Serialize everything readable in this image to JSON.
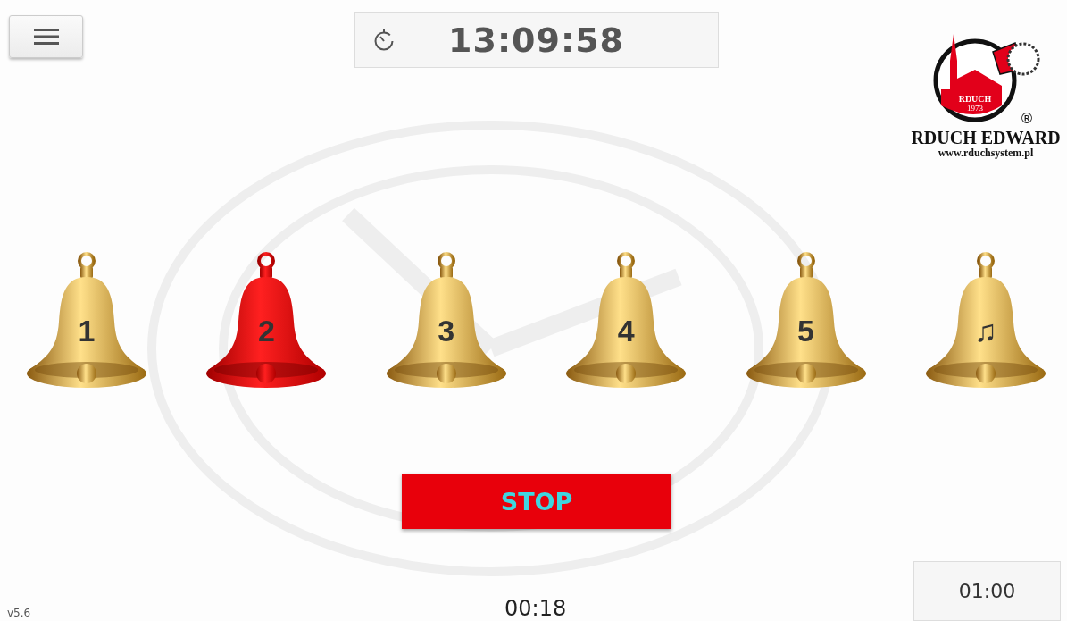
{
  "clock": {
    "time": "13:09:58"
  },
  "logo": {
    "badge_name": "RDUCH",
    "badge_year": "1973",
    "registered": "®",
    "company": "RDUCH EDWARD",
    "website": "www.rduchsystem.pl"
  },
  "bells": [
    {
      "label": "1",
      "selected": false
    },
    {
      "label": "2",
      "selected": true
    },
    {
      "label": "3",
      "selected": false
    },
    {
      "label": "4",
      "selected": false
    },
    {
      "label": "5",
      "selected": false
    },
    {
      "label": "♫",
      "selected": false
    }
  ],
  "stop_button": {
    "label": "STOP"
  },
  "footer": {
    "version": "v5.6",
    "elapsed": "00:18",
    "duration": "01:00"
  }
}
